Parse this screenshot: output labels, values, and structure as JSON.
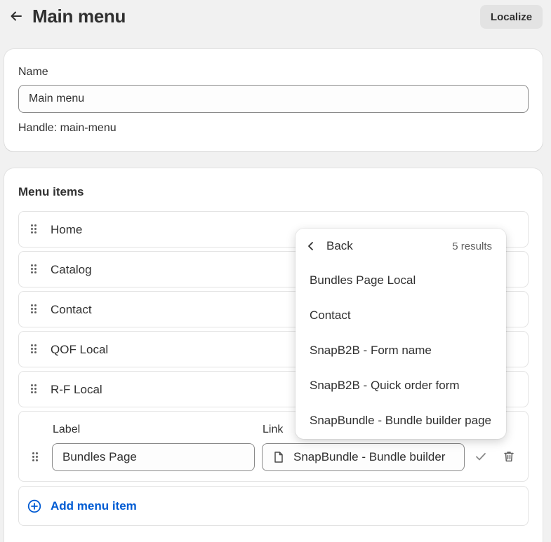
{
  "header": {
    "title": "Main menu",
    "back_icon": "arrow-left-icon",
    "localize_label": "Localize"
  },
  "name_card": {
    "label": "Name",
    "value": "Main menu",
    "handle": "Handle: main-menu"
  },
  "menu_card": {
    "title": "Menu items",
    "items": [
      {
        "label": "Home"
      },
      {
        "label": "Catalog"
      },
      {
        "label": "Contact"
      },
      {
        "label": "QOF Local"
      },
      {
        "label": "R-F Local"
      }
    ],
    "edit_item": {
      "label_heading": "Label",
      "link_heading": "Link",
      "label_value": "Bundles Page",
      "link_value": "SnapBundle - Bundle builder",
      "link_icon": "page-icon",
      "confirm_icon": "checkmark-icon",
      "delete_icon": "trash-icon"
    },
    "add_label": "Add menu item",
    "add_icon": "plus-circle-icon"
  },
  "popover": {
    "back_label": "Back",
    "back_icon": "chevron-left-icon",
    "count": "5 results",
    "results": [
      "Bundles Page Local",
      "Contact",
      "SnapB2B - Form name",
      "SnapB2B - Quick order form",
      "SnapBundle - Bundle builder page"
    ]
  },
  "colors": {
    "background": "#f1f1f1",
    "card": "#ffffff",
    "text": "#303030",
    "link_accent": "#005bd3",
    "button_gray": "#e3e3e3"
  }
}
